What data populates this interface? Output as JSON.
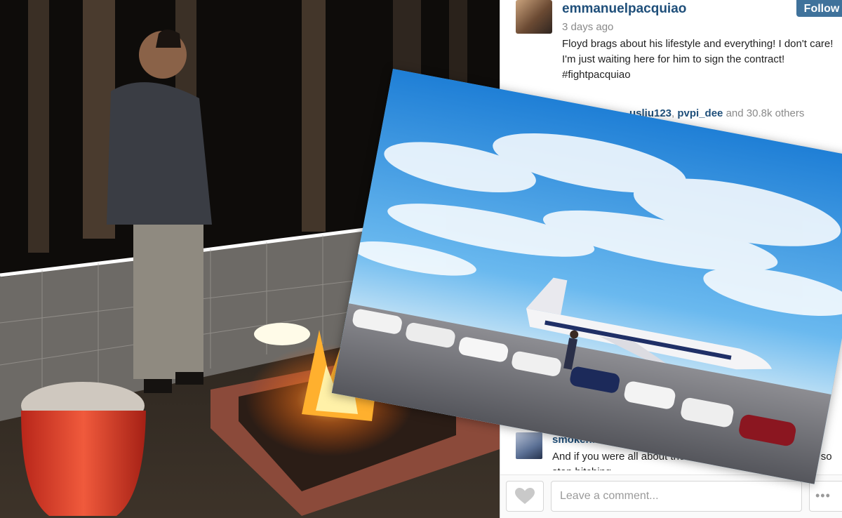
{
  "post": {
    "username": "emmanuelpacquiao",
    "timestamp": "3 days ago",
    "caption": "Floyd brags about his lifestyle and everything! I don't care! I'm just waiting here for him to sign the contract! #fightpacquiao",
    "follow_label": "Follow"
  },
  "likes": {
    "partial_user": "usliu123",
    "user2": "pvpi_dee",
    "separator": ", ",
    "suffix": " and 30.8k others"
  },
  "comment": {
    "username": "smokenlcash",
    "text": "And if you were all about the m... what already happened so stop bitching..."
  },
  "comment_input": {
    "placeholder": "Leave a comment..."
  },
  "more_label": "•••",
  "icons": {
    "like": "heart-icon",
    "more": "ellipsis-icon"
  },
  "colors": {
    "link_blue": "#1f4f7a",
    "follow_button": "#3f729b"
  }
}
